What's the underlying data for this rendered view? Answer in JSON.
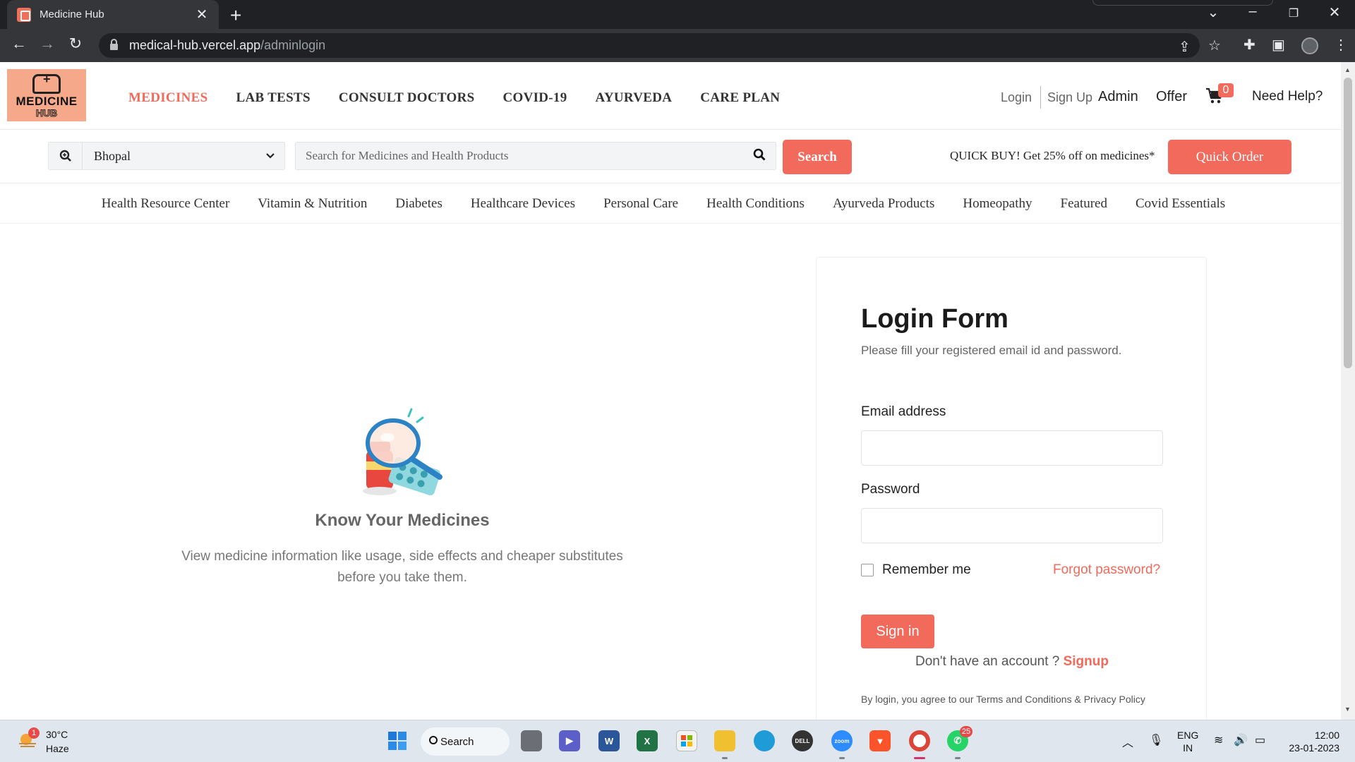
{
  "browser": {
    "tab_title": "Medicine Hub",
    "new_tab": "+",
    "tab_close": "✕",
    "url_host": "medical-hub.vercel.app",
    "url_path": "/adminlogin"
  },
  "header": {
    "logo_text_1": "MEDICINE",
    "logo_text_2": "HUB",
    "nav": [
      "MEDICINES",
      "LAB TESTS",
      "CONSULT DOCTORS",
      "COVID-19",
      "AYURVEDA",
      "CARE PLAN"
    ],
    "login": "Login",
    "signup": "Sign Up",
    "admin": "Admin",
    "offer": "Offer",
    "cart_count": "0",
    "help": "Need Help?"
  },
  "searchbar": {
    "location": "Bhopal",
    "placeholder": "Search for Medicines and Health Products",
    "search_button": "Search",
    "quick_buy_text": "QUICK BUY! Get 25% off on medicines*",
    "quick_order_button": "Quick Order"
  },
  "categories": [
    "Health Resource Center",
    "Vitamin & Nutrition",
    "Diabetes",
    "Healthcare Devices",
    "Personal Care",
    "Health Conditions",
    "Ayurveda Products",
    "Homeopathy",
    "Featured",
    "Covid Essentials"
  ],
  "promo": {
    "title": "Know Your Medicines",
    "line1": "View medicine information like usage, side effects and cheaper substitutes",
    "line2": "before you take them."
  },
  "login_form": {
    "title": "Login Form",
    "subtitle": "Please fill your registered email id and password.",
    "email_label": "Email address",
    "email_value": "",
    "password_label": "Password",
    "password_value": "",
    "remember_label": "Remember me",
    "forgot_link": "Forgot password?",
    "signin_button": "Sign in",
    "no_account_text": "Don't have an account ?",
    "signup_link": "Signup",
    "terms_text": "By login, you agree to our Terms and Conditions & Privacy Policy"
  },
  "taskbar": {
    "temperature": "30°C",
    "condition": "Haze",
    "weather_badge": "1",
    "search_label": "Search",
    "whatsapp_badge": "25",
    "lang_1": "ENG",
    "lang_2": "IN",
    "time": "12:00",
    "date": "23-01-2023"
  },
  "colors": {
    "accent": "#f16a5b",
    "chrome_dark": "#202124",
    "chrome_mid": "#35363a",
    "taskbar": "#dfe6ee"
  }
}
